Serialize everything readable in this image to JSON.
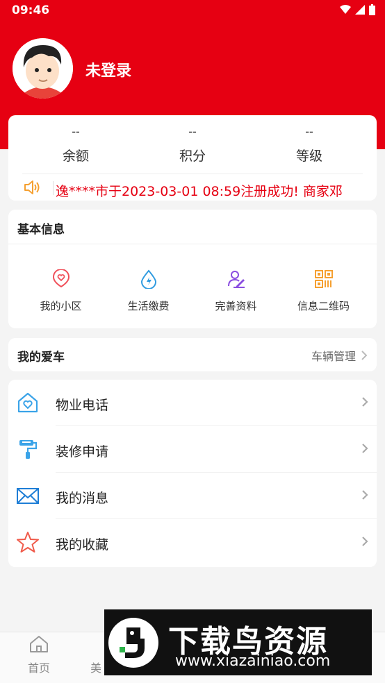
{
  "status_bar": {
    "time": "09:46"
  },
  "profile": {
    "login_status": "未登录"
  },
  "stats": [
    {
      "value": "--",
      "label": "余额"
    },
    {
      "value": "--",
      "label": "积分"
    },
    {
      "value": "--",
      "label": "等级"
    }
  ],
  "notice": {
    "text": "逸****市于2023-03-01 08:59注册成功!     商家邓"
  },
  "basic_info": {
    "title": "基本信息",
    "items": [
      {
        "label": "我的小区",
        "icon": "heart-location-icon",
        "color": "#f0505a"
      },
      {
        "label": "生活缴费",
        "icon": "water-drop-bolt-icon",
        "color": "#2f9be0"
      },
      {
        "label": "完善资料",
        "icon": "user-edit-icon",
        "color": "#8a4de0"
      },
      {
        "label": "信息二维码",
        "icon": "qr-code-icon",
        "color": "#f5a031"
      }
    ]
  },
  "my_car": {
    "title": "我的爱车",
    "action": "车辆管理"
  },
  "menu": [
    {
      "label": "物业电话",
      "icon": "house-heart-icon"
    },
    {
      "label": "装修申请",
      "icon": "paint-roller-icon"
    },
    {
      "label": "我的消息",
      "icon": "envelope-icon"
    },
    {
      "label": "我的收藏",
      "icon": "star-icon"
    }
  ],
  "tabbar": {
    "tabs": [
      {
        "label": "首页"
      },
      {
        "label": "美"
      }
    ]
  },
  "watermark": {
    "title": "下载鸟资源",
    "url": "www.xiazainiao.com"
  },
  "colors": {
    "primary": "#e60012",
    "background": "#f4f4f4"
  }
}
